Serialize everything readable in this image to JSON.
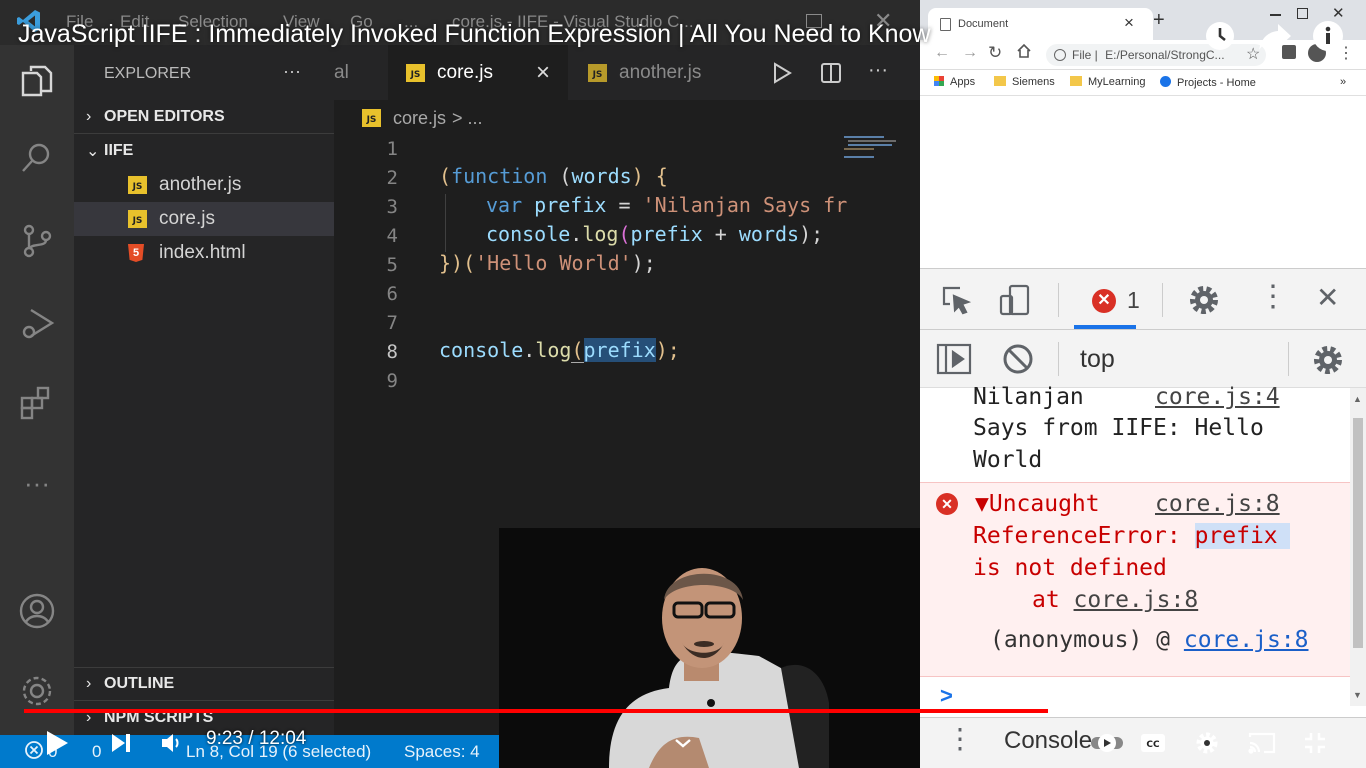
{
  "video": {
    "title": "JavaScript IIFE : Immediately Invoked Function Expression | All You Need to Know",
    "time": "9:23 / 12:04",
    "progress": 0.777
  },
  "vscode": {
    "menu": [
      "File",
      "Edit",
      "Selection",
      "View",
      "Go",
      "..."
    ],
    "window_title": "core.js - IIFE - Visual Studio C...",
    "sidebar": {
      "title": "EXPLORER",
      "more": "···",
      "open_editors": "OPEN EDITORS",
      "folder": "IIFE",
      "files": [
        "another.js",
        "core.js",
        "index.html"
      ],
      "outline": "OUTLINE",
      "npm": "NPM SCRIPTS"
    },
    "tabs": {
      "partial": "al",
      "active": "core.js",
      "other": "another.js",
      "close": "×",
      "more": "···"
    },
    "breadcrumb": {
      "file": "core.js",
      "rest": "> ..."
    },
    "line_numbers": [
      "1",
      "2",
      "3",
      "4",
      "5",
      "6",
      "7",
      "8",
      "9"
    ],
    "code": {
      "l2a": "(",
      "l2b": "function",
      "l2c": " (",
      "l2d": "words",
      "l2e": ") {",
      "l3a": "var",
      "l3b": " prefix",
      "l3c": " = ",
      "l3d": "'Nilanjan Says fr",
      "l4a": "console",
      "l4b": ".",
      "l4c": "log",
      "l4d": "(",
      "l4e": "prefix",
      "l4f": " + ",
      "l4g": "words",
      "l4h": ");",
      "l5a": "})",
      "l5b": "(",
      "l5c": "'Hello World'",
      "l5d": ");",
      "l8a": "console",
      "l8b": ".",
      "l8c": "log",
      "l8d": "(",
      "l8e": "prefix",
      "l8f": ");"
    },
    "status": {
      "errors": "0",
      "warnings": "0",
      "position": "Ln 8, Col 19 (6 selected)",
      "spaces": "Spaces: 4"
    }
  },
  "chrome": {
    "tab_title": "Document",
    "tab_close": "×",
    "new_tab": "+",
    "url_prefix": "File |",
    "url": "E:/Personal/StrongC...",
    "bookmarks": [
      "Apps",
      "Siemens",
      "MyLearning",
      "Projects - Home"
    ],
    "bookmarks_more": "»",
    "devtools": {
      "error_count": "1",
      "context": "top",
      "log_text_1": "Nilanjan",
      "log_text_2": "Says from IIFE: Hello",
      "log_text_3": "World",
      "log_source": "core.js:4",
      "err_prefix": "▼Uncaught",
      "err_source": "core.js:8",
      "err_type": "ReferenceError: ",
      "err_var": "prefix",
      "err_line2": "is not defined",
      "err_at": "at ",
      "err_at_link": "core.js:8",
      "err_anon": "(anonymous) @ ",
      "err_anon_link": "core.js:8",
      "prompt": ">",
      "drawer_tab": "Console"
    }
  },
  "colors": {
    "vscode_bg": "#1e1e1e",
    "status_blue": "#007acc",
    "keyword": "#569cd6",
    "string": "#ce9178",
    "var": "#9cdcfe",
    "func": "#dcdcaa",
    "yt_red": "#ff0000",
    "error_red": "#c80000"
  }
}
